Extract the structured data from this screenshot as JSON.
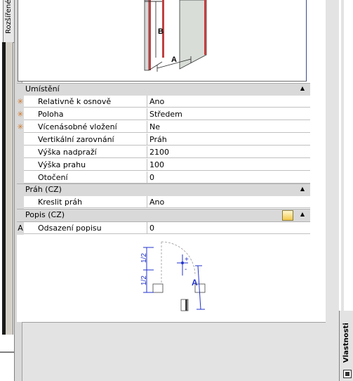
{
  "side_tab_left": {
    "label": "Rozšířené"
  },
  "right_tab": {
    "label": "Vlastnosti"
  },
  "sections": {
    "umisteni": {
      "title": "Umístění"
    },
    "prah": {
      "title": "Práh (CZ)"
    },
    "popis": {
      "title": "Popis (CZ)"
    }
  },
  "props": {
    "relativne": {
      "name": "Relativně k osnově",
      "value": "Ano",
      "marker": "✳"
    },
    "poloha": {
      "name": "Poloha",
      "value": "Středem",
      "marker": "✳"
    },
    "vicenasobne": {
      "name": "Vícenásobné vložení",
      "value": "Ne",
      "marker": "✳"
    },
    "vertikalni": {
      "name": "Vertikální zarovnání",
      "value": "Práh"
    },
    "vyska_nadprazi": {
      "name": "Výška nadpraží",
      "value": "2100"
    },
    "vyska_prahu": {
      "name": "Výška prahu",
      "value": "100"
    },
    "otoceni": {
      "name": "Otočení",
      "value": "0"
    },
    "kreslit_prah": {
      "name": "Kreslit práh",
      "value": "Ano"
    },
    "odsazeni_popisu": {
      "name": "Odsazení popisu",
      "value": "0",
      "marker": "A"
    }
  },
  "top_diagram": {
    "label_b": "B",
    "label_a": "A"
  },
  "bottom_diagram": {
    "label_half_top": "1/2",
    "label_half_bottom": "1/2",
    "label_plus": "+",
    "label_minus": "-",
    "label_a": "A"
  },
  "colors": {
    "accent_blue": "#2233cc",
    "frame_red": "#b03030"
  }
}
